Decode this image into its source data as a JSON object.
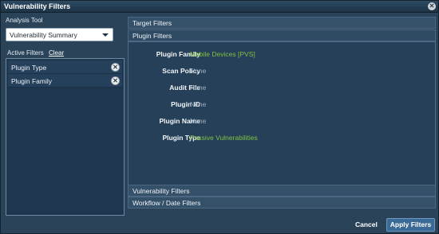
{
  "window": {
    "title": "Vulnerability Filters",
    "close_glyph": "✕"
  },
  "analysis_tool": {
    "label": "Analysis Tool",
    "selected": "Vulnerability Summary"
  },
  "active_filters": {
    "label": "Active Filters",
    "clear_label": "Clear",
    "items": [
      {
        "label": "Plugin Type",
        "remove_glyph": "✕"
      },
      {
        "label": "Plugin Family",
        "remove_glyph": "✕"
      }
    ]
  },
  "sections": {
    "target": "Target Filters",
    "plugin": "Plugin Filters",
    "vulnerability": "Vulnerability Filters",
    "workflow": "Workflow / Date Filters"
  },
  "plugin_filters": [
    {
      "key": "Plugin Family",
      "value": "Mobile Devices [PVS]",
      "state": "set"
    },
    {
      "key": "Scan Policy",
      "value": "None",
      "state": "none"
    },
    {
      "key": "Audit File",
      "value": "None",
      "state": "none"
    },
    {
      "key": "Plugin ID",
      "value": "None",
      "state": "none"
    },
    {
      "key": "Plugin Name",
      "value": "None",
      "state": "none"
    },
    {
      "key": "Plugin Type",
      "value": "Passive Vulnerabilities",
      "state": "set"
    }
  ],
  "buttons": {
    "cancel": "Cancel",
    "apply": "Apply Filters"
  },
  "colors": {
    "accent_value": "#7cc243",
    "muted_value": "#9fb0bf",
    "background": "#2b4359"
  }
}
